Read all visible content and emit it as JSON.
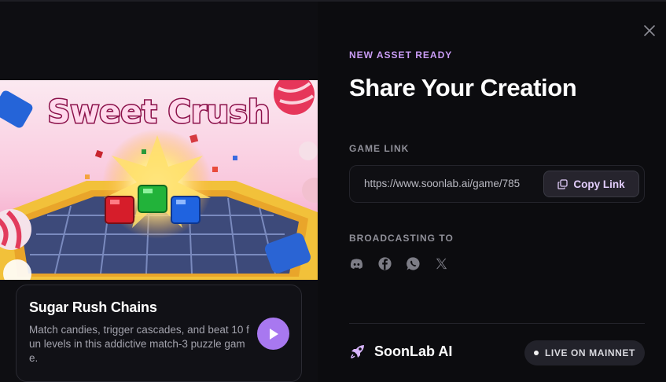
{
  "header": {
    "eyebrow": "NEW ASSET READY",
    "title": "Share Your Creation",
    "close_icon": "close-icon"
  },
  "game": {
    "banner_text": "Sweet Crush",
    "title": "Sugar Rush Chains",
    "description": "Match candies, trigger cascades, and beat 10 fun levels in this addictive match-3 puzzle game.",
    "play_icon": "play-icon"
  },
  "link": {
    "label": "GAME LINK",
    "url": "https://www.soonlab.ai/game/785",
    "copy_label": "Copy Link",
    "copy_icon": "copy-icon"
  },
  "broadcast": {
    "label": "BROADCASTING TO",
    "platforms": [
      "discord-icon",
      "facebook-icon",
      "whatsapp-icon",
      "x-icon"
    ]
  },
  "footer": {
    "brand": "SoonLab AI",
    "brand_icon": "rocket-icon",
    "status": "LIVE ON MAINNET"
  },
  "colors": {
    "accent": "#a878f0",
    "eyebrow": "#c99cf5",
    "background": "#0c0c0f"
  }
}
